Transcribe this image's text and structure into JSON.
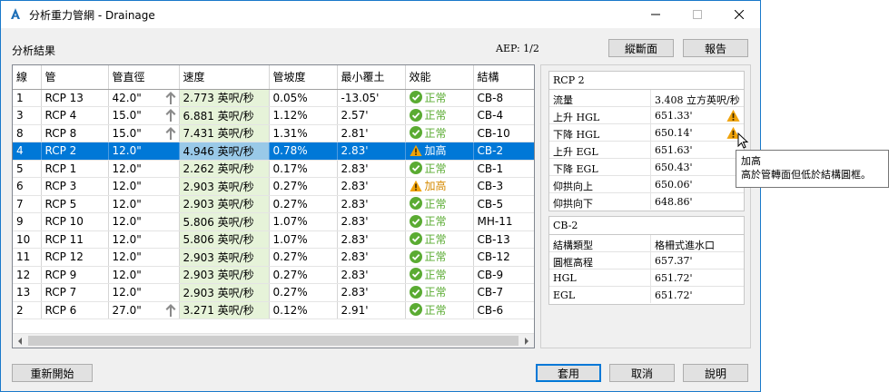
{
  "window": {
    "title": "分析重力管網 - Drainage"
  },
  "header": {
    "section_label": "分析結果",
    "aep": "AEP: 1/2",
    "profile_button": "縱斷面",
    "report_button": "報告"
  },
  "table": {
    "columns": [
      "線",
      "管",
      "管直徑",
      "速度",
      "管坡度",
      "最小覆土",
      "效能",
      "結構"
    ],
    "rows": [
      {
        "line": "1",
        "pipe": "RCP 13",
        "diameter": "42.0\"",
        "arrow": true,
        "velocity": "2.773 英呎/秒",
        "slope": "0.05%",
        "cover": "-13.05'",
        "status": "ok",
        "status_text": "正常",
        "structure": "CB-8"
      },
      {
        "line": "3",
        "pipe": "RCP 4",
        "diameter": "15.0\"",
        "arrow": true,
        "velocity": "6.881 英呎/秒",
        "slope": "1.12%",
        "cover": "2.57'",
        "status": "ok",
        "status_text": "正常",
        "structure": "CB-4"
      },
      {
        "line": "8",
        "pipe": "RCP 8",
        "diameter": "15.0\"",
        "arrow": true,
        "velocity": "7.431 英呎/秒",
        "slope": "1.31%",
        "cover": "2.81'",
        "status": "ok",
        "status_text": "正常",
        "structure": "CB-10"
      },
      {
        "line": "4",
        "pipe": "RCP 2",
        "diameter": "12.0\"",
        "arrow": false,
        "velocity": "4.946 英呎/秒",
        "slope": "0.78%",
        "cover": "2.83'",
        "status": "warn",
        "status_text": "加高",
        "structure": "CB-2",
        "selected": true
      },
      {
        "line": "5",
        "pipe": "RCP 1",
        "diameter": "12.0\"",
        "arrow": false,
        "velocity": "2.262 英呎/秒",
        "slope": "0.17%",
        "cover": "2.83'",
        "status": "ok",
        "status_text": "正常",
        "structure": "CB-1"
      },
      {
        "line": "6",
        "pipe": "RCP 3",
        "diameter": "12.0\"",
        "arrow": false,
        "velocity": "2.903 英呎/秒",
        "slope": "0.27%",
        "cover": "2.83'",
        "status": "warn",
        "status_text": "加高",
        "structure": "CB-3"
      },
      {
        "line": "7",
        "pipe": "RCP 5",
        "diameter": "12.0\"",
        "arrow": false,
        "velocity": "2.903 英呎/秒",
        "slope": "0.27%",
        "cover": "2.83'",
        "status": "ok",
        "status_text": "正常",
        "structure": "CB-5"
      },
      {
        "line": "9",
        "pipe": "RCP 10",
        "diameter": "12.0\"",
        "arrow": false,
        "velocity": "5.806 英呎/秒",
        "slope": "1.07%",
        "cover": "2.83'",
        "status": "ok",
        "status_text": "正常",
        "structure": "MH-11"
      },
      {
        "line": "10",
        "pipe": "RCP 11",
        "diameter": "12.0\"",
        "arrow": false,
        "velocity": "5.806 英呎/秒",
        "slope": "1.07%",
        "cover": "2.83'",
        "status": "ok",
        "status_text": "正常",
        "structure": "CB-13"
      },
      {
        "line": "11",
        "pipe": "RCP 12",
        "diameter": "12.0\"",
        "arrow": false,
        "velocity": "2.903 英呎/秒",
        "slope": "0.27%",
        "cover": "2.83'",
        "status": "ok",
        "status_text": "正常",
        "structure": "CB-12"
      },
      {
        "line": "12",
        "pipe": "RCP 9",
        "diameter": "12.0\"",
        "arrow": false,
        "velocity": "2.903 英呎/秒",
        "slope": "0.27%",
        "cover": "2.83'",
        "status": "ok",
        "status_text": "正常",
        "structure": "CB-9"
      },
      {
        "line": "13",
        "pipe": "RCP 7",
        "diameter": "12.0\"",
        "arrow": false,
        "velocity": "2.903 英呎/秒",
        "slope": "0.27%",
        "cover": "2.83'",
        "status": "ok",
        "status_text": "正常",
        "structure": "CB-7"
      },
      {
        "line": "2",
        "pipe": "RCP 6",
        "diameter": "27.0\"",
        "arrow": true,
        "velocity": "3.271 英呎/秒",
        "slope": "0.12%",
        "cover": "2.91'",
        "status": "ok",
        "status_text": "正常",
        "structure": "CB-6"
      }
    ]
  },
  "pipe_props": {
    "title": "RCP 2",
    "rows": [
      {
        "key": "流量",
        "value": "3.408 立方英呎/秒",
        "warn": false
      },
      {
        "key": "上升 HGL",
        "value": "651.33'",
        "warn": true
      },
      {
        "key": "下降 HGL",
        "value": "650.14'",
        "warn": true
      },
      {
        "key": "上升 EGL",
        "value": "651.63'",
        "warn": false
      },
      {
        "key": "下降 EGL",
        "value": "650.43'",
        "warn": false
      },
      {
        "key": "仰拱向上",
        "value": "650.06'",
        "warn": false
      },
      {
        "key": "仰拱向下",
        "value": "648.86'",
        "warn": false
      }
    ]
  },
  "structure_props": {
    "title": "CB-2",
    "rows": [
      {
        "key": "結構類型",
        "value": "格柵式進水口"
      },
      {
        "key": "圓框高程",
        "value": "657.37'"
      },
      {
        "key": "HGL",
        "value": "651.72'"
      },
      {
        "key": "EGL",
        "value": "651.72'"
      }
    ]
  },
  "tooltip": {
    "title": "加高",
    "body": "高於管轉面但低於結構圓框。"
  },
  "footer": {
    "reset": "重新開始",
    "apply": "套用",
    "cancel": "取消",
    "help": "說明"
  },
  "colors": {
    "accent": "#0078d7",
    "ok": "#5aab32",
    "warn": "#f0a30a",
    "velocity_bg": "#e6f3d9"
  }
}
